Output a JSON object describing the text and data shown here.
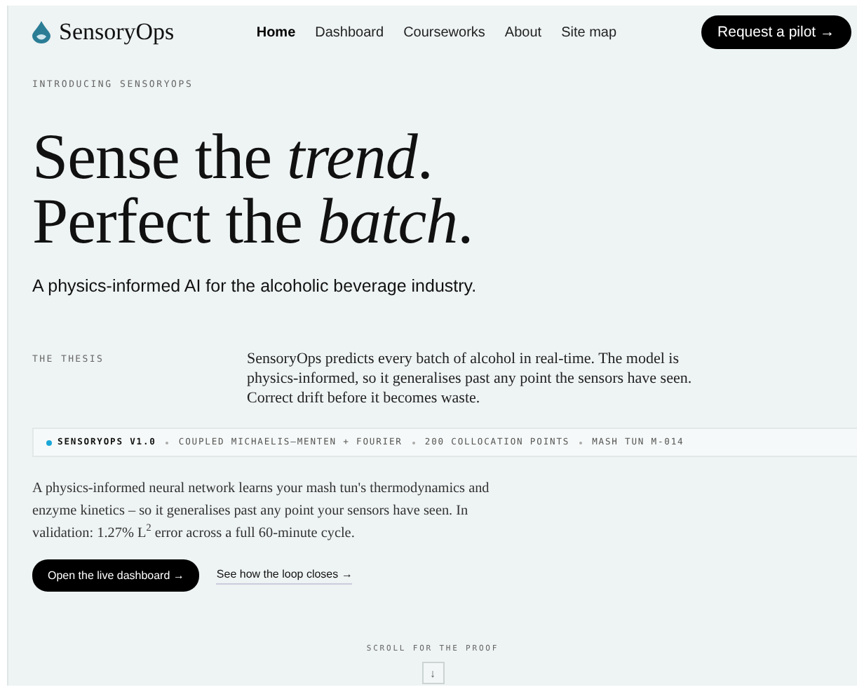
{
  "header": {
    "brand": "SensoryOps",
    "nav": [
      {
        "label": "Home",
        "selected": true
      },
      {
        "label": "Dashboard",
        "selected": false
      },
      {
        "label": "Courseworks",
        "selected": false
      },
      {
        "label": "About",
        "selected": false
      },
      {
        "label": "Site map",
        "selected": false
      }
    ],
    "cta": "Request a pilot →"
  },
  "hero": {
    "eyebrow": "INTRODUCING SENSORYOPS",
    "headline": [
      "Sense the *trend*.",
      "Perfect the *batch*."
    ],
    "subtitle": "A physics-informed AI for the alcoholic beverage industry."
  },
  "thesis": {
    "label": "THE THESIS",
    "text": "SensoryOps predicts every batch of alcohol in real-time. The model is physics-informed, so it generalises past any point the sensors have seen. Correct drift before it becomes waste."
  },
  "spec_bar": [
    "SENSORYOPS V1.0",
    "COUPLED MICHAELIS–MENTEN + FOURIER",
    "200 COLLOCATION POINTS",
    "MASH TUN M-014"
  ],
  "body": "A physics-informed neural network learns your mash tun's thermodynamics and enzyme kinetics – so it generalises past any point your sensors have seen. In validation: 1.27% L$^{2}$ error across a full 60-minute cycle.",
  "actions": [
    {
      "kind": "primary",
      "label": "Open the live dashboard →"
    },
    {
      "kind": "link",
      "label": "See how the loop closes →"
    }
  ],
  "scroll": {
    "label": "SCROLL FOR THE PROOF",
    "arrow": "↓"
  }
}
